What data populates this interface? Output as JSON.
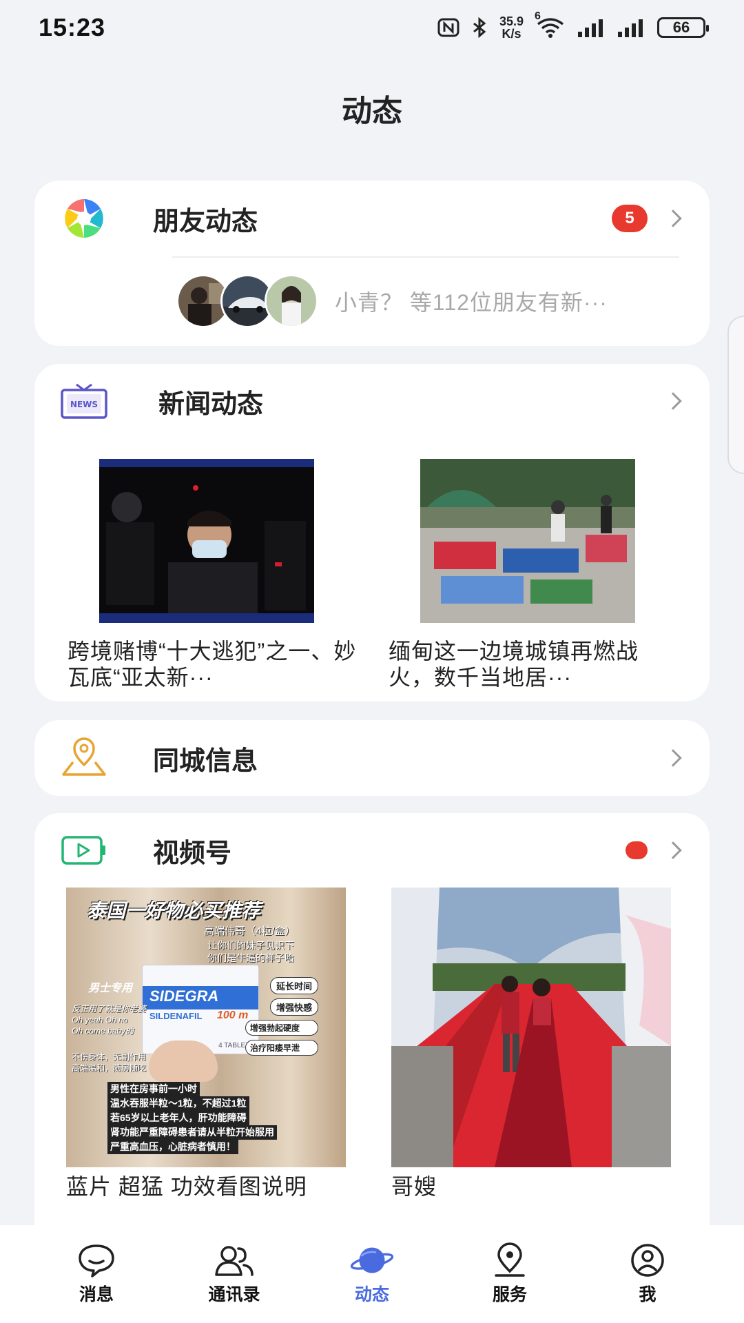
{
  "status_bar": {
    "time": "15:23",
    "network_speed_value": "35.9",
    "network_speed_unit": "K/s",
    "wifi_label": "6",
    "battery": "66"
  },
  "page": {
    "title": "动态"
  },
  "friends": {
    "label": "朋友动态",
    "badge": "5",
    "update_text": "小青？ 等112位朋友有新···",
    "icon": "colorful-aperture-icon"
  },
  "news": {
    "label": "新闻动态",
    "icon": "news-tv-icon",
    "items": [
      {
        "title": "跨境赌博“十大逃犯”之一、妙瓦底“亚太新···"
      },
      {
        "title": "缅甸这一边境城镇再燃战火，数千当地居···"
      }
    ]
  },
  "local": {
    "label": "同城信息",
    "icon": "location-pin-icon"
  },
  "channels": {
    "label": "视频号",
    "icon": "video-channel-icon",
    "items": [
      {
        "title": "蓝片 超猛 功效看图说明",
        "thumb": {
          "headline": "泰国一好物必买推荐",
          "sub1": "高端伟哥（4粒/盒）",
          "sub2": "让你们的妹子见识下",
          "sub3": "你们是牛逼的样子哈",
          "tag": "男士专用",
          "brand": "SIDEGRA",
          "generic": "SILDENAFIL",
          "dose": "100 m",
          "tablets": "4 TABLETS",
          "pills": [
            "延长时间",
            "增强快感",
            "增强勃起硬度",
            "治疗阳痿早泄"
          ],
          "side_text": [
            "反正用了就是你老婆",
            "Oh yeah Oh no",
            "Oh come baby的"
          ],
          "side_text2": [
            "不伤身体，无副作用",
            "高端温和，随房随吃"
          ],
          "instructions": [
            "男性在房事前一小时",
            "温水吞服半粒～1粒，不超过1粒",
            "若65岁以上老年人，肝功能障碍",
            "肾功能严重障碍患者请从半粒开始服用",
            "严重高血压，心脏病者慎用！"
          ]
        }
      },
      {
        "title": "哥嫂"
      }
    ]
  },
  "tabbar": {
    "items": [
      {
        "label": "消息",
        "icon": "chat-bubble-icon"
      },
      {
        "label": "通讯录",
        "icon": "contacts-icon"
      },
      {
        "label": "动态",
        "icon": "planet-icon"
      },
      {
        "label": "服务",
        "icon": "location-service-icon"
      },
      {
        "label": "我",
        "icon": "profile-icon"
      }
    ]
  },
  "colors": {
    "accent": "#4a6ae0",
    "badge_red": "#e8392e"
  }
}
